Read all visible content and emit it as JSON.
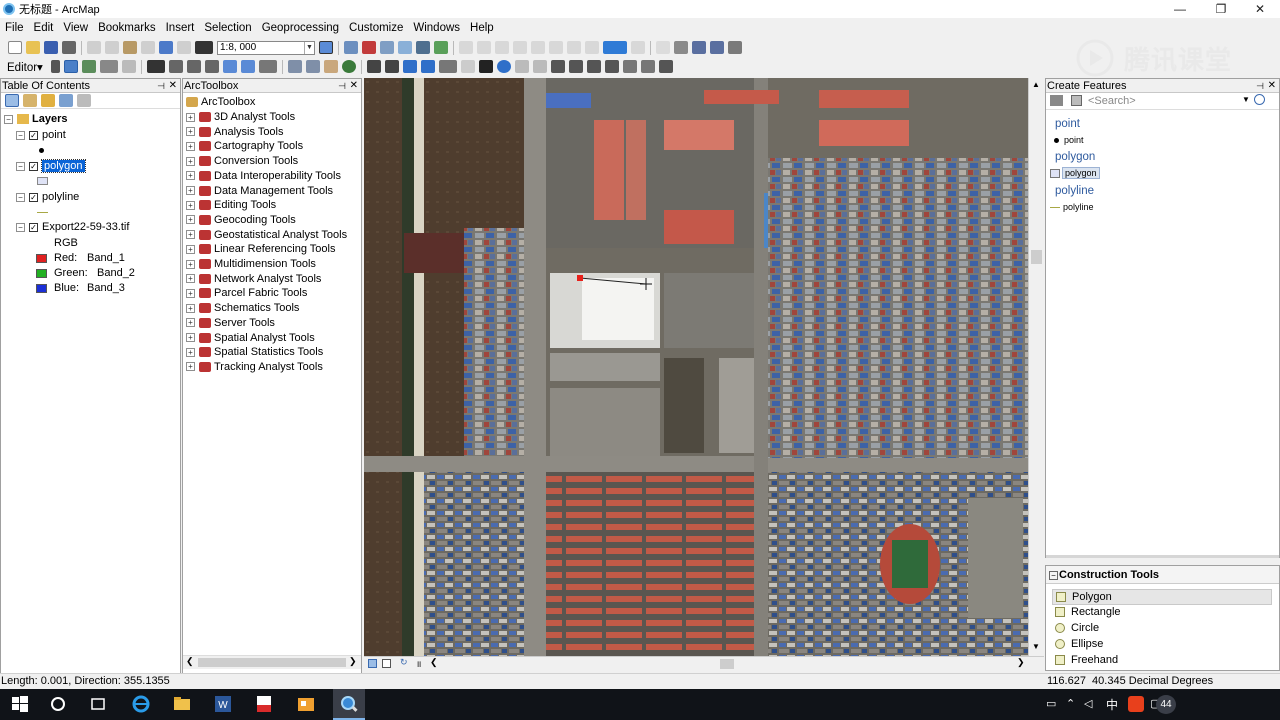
{
  "window": {
    "title": "无标题 - ArcMap",
    "minimize": "—",
    "restore": "❐",
    "close": "✕"
  },
  "menu": [
    "File",
    "Edit",
    "View",
    "Bookmarks",
    "Insert",
    "Selection",
    "Geoprocessing",
    "Customize",
    "Windows",
    "Help"
  ],
  "toolbar": {
    "scale": "1:8, 000",
    "editor_label": "Editor▾"
  },
  "watermark": "腾讯课堂",
  "toc": {
    "title": "Table Of Contents",
    "root": "Layers",
    "layers": [
      {
        "name": "point",
        "symbol": "point"
      },
      {
        "name": "polygon",
        "symbol": "polygon",
        "selected": true
      },
      {
        "name": "polyline",
        "symbol": "line"
      }
    ],
    "raster": {
      "name": "Export22-59-33.tif",
      "type": "RGB",
      "bands": [
        {
          "channel": "Red:",
          "band": "Band_1",
          "color": "#e02020"
        },
        {
          "channel": "Green:",
          "band": "Band_2",
          "color": "#22b022"
        },
        {
          "channel": "Blue:",
          "band": "Band_3",
          "color": "#1b2fd6"
        }
      ]
    }
  },
  "toolbox": {
    "title": "ArcToolbox",
    "root": "ArcToolbox",
    "items": [
      "3D Analyst Tools",
      "Analysis Tools",
      "Cartography Tools",
      "Conversion Tools",
      "Data Interoperability Tools",
      "Data Management Tools",
      "Editing Tools",
      "Geocoding Tools",
      "Geostatistical Analyst Tools",
      "Linear Referencing Tools",
      "Multidimension Tools",
      "Network Analyst Tools",
      "Parcel Fabric Tools",
      "Schematics Tools",
      "Server Tools",
      "Spatial Analyst Tools",
      "Spatial Statistics Tools",
      "Tracking Analyst Tools"
    ]
  },
  "create_features": {
    "title": "Create Features",
    "search_placeholder": "<Search>",
    "groups": [
      {
        "group": "point",
        "template": "point"
      },
      {
        "group": "polygon",
        "template": "polygon"
      },
      {
        "group": "polyline",
        "template": "polyline"
      }
    ]
  },
  "construction_tools": {
    "title": "Construction Tools",
    "items": [
      "Polygon",
      "Rectangle",
      "Circle",
      "Ellipse",
      "Freehand"
    ]
  },
  "status": {
    "left": "Length: 0.001, Direction: 355.1355",
    "right": "116.627  40.345 Decimal Degrees"
  },
  "taskbar": {
    "ime": "中",
    "badge": "44"
  },
  "colors": {
    "accent": "#3399ff",
    "selection": "#0a64d7"
  }
}
